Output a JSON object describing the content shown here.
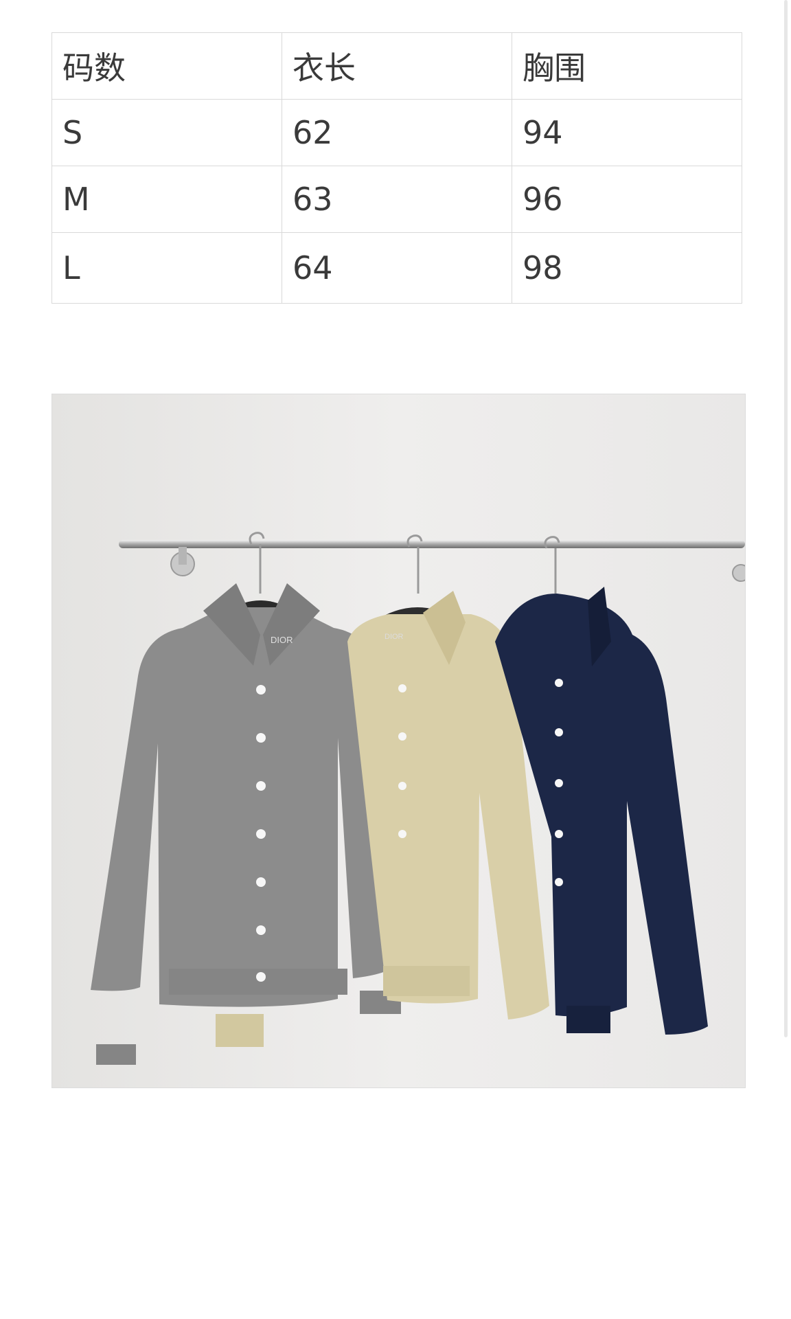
{
  "size_table": {
    "headers": [
      "码数",
      "衣长",
      "胸围"
    ],
    "rows": [
      [
        "S",
        "62",
        "94"
      ],
      [
        "M",
        "63",
        "96"
      ],
      [
        "L",
        "64",
        "98"
      ]
    ]
  },
  "photo": {
    "garments": [
      {
        "color": "#8c8c8c",
        "label": "DIOR"
      },
      {
        "color": "#d9cfa8",
        "label": "DIOR"
      },
      {
        "color": "#1c2747",
        "label": ""
      }
    ],
    "wall_color": "#ecebea",
    "button_color": "#f7f7f7"
  }
}
